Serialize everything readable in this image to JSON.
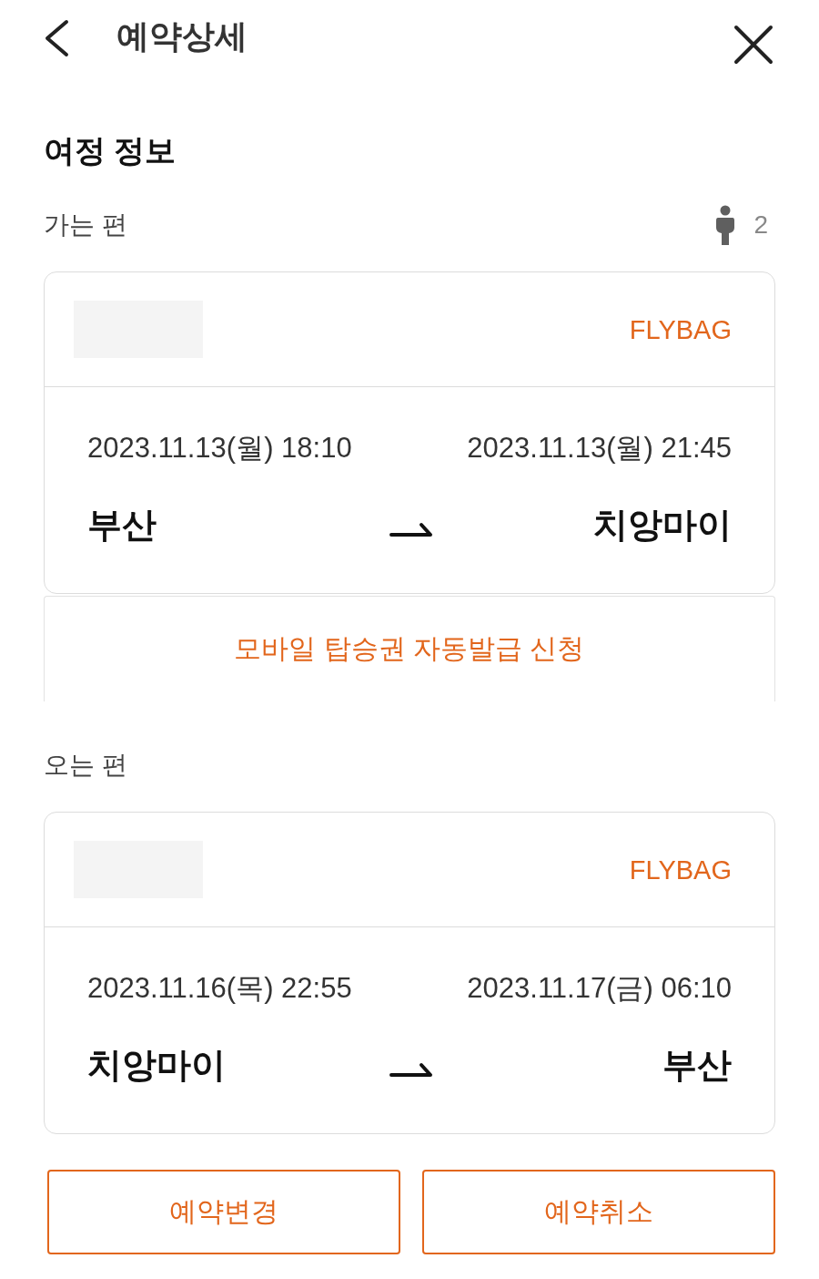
{
  "header": {
    "title": "예약상세"
  },
  "section_title": "여정 정보",
  "flights": [
    {
      "label": "가는 편",
      "passengers": "2",
      "tag": "FLYBAG",
      "departure": {
        "datetime": "2023.11.13(월) 18:10",
        "city": "부산"
      },
      "arrival": {
        "datetime": "2023.11.13(월) 21:45",
        "city": "치앙마이"
      },
      "action": "모바일 탑승권 자동발급 신청"
    },
    {
      "label": "오는 편",
      "tag": "FLYBAG",
      "departure": {
        "datetime": "2023.11.16(목) 22:55",
        "city": "치앙마이"
      },
      "arrival": {
        "datetime": "2023.11.17(금) 06:10",
        "city": "부산"
      }
    }
  ],
  "buttons": [
    "예약변경",
    "예약취소"
  ]
}
